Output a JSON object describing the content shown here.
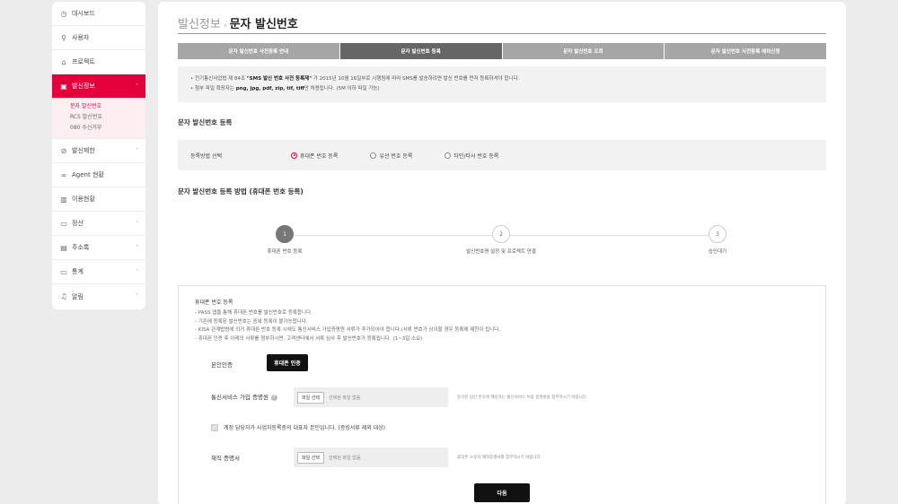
{
  "sidebar": {
    "items": [
      {
        "label": "대시보드",
        "icon": "dashboard-icon",
        "glyph": "◷"
      },
      {
        "label": "사용자",
        "icon": "user-icon",
        "glyph": "⚲"
      },
      {
        "label": "프로젝트",
        "icon": "project-icon",
        "glyph": "⌂"
      },
      {
        "label": "발신정보",
        "icon": "sender-info-icon",
        "glyph": "▣"
      },
      {
        "label": "발신제한",
        "icon": "block-icon",
        "glyph": "⊘"
      },
      {
        "label": "Agent 현황",
        "icon": "link-icon",
        "glyph": "∞"
      },
      {
        "label": "이용현황",
        "icon": "usage-chart-icon",
        "glyph": "▥"
      },
      {
        "label": "정산",
        "icon": "billing-icon",
        "glyph": "▭"
      },
      {
        "label": "주소록",
        "icon": "address-book-icon",
        "glyph": "▤"
      },
      {
        "label": "통계",
        "icon": "stats-monitor-icon",
        "glyph": "▭"
      },
      {
        "label": "알림",
        "icon": "bell-icon",
        "glyph": "♫"
      }
    ],
    "sub_items": [
      "문자 발신번호",
      "RCS 발신번호",
      "080 수신거부"
    ],
    "chevron_down": "˅",
    "chevron_up": "˄"
  },
  "breadcrumb": {
    "parent": "발신정보",
    "separator": "›",
    "current": "문자 발신번호"
  },
  "tabs": [
    "문자 발신번호 사전등록 안내",
    "문자 발신번호 등록",
    "문자 발신번호 조회",
    "문자 발신번호 사전등록 예외신청"
  ],
  "notice": {
    "line1_pre": "• 전기통신사업법 제 84조 ",
    "line1_bold": "\"SMS 발신 번호 사전 등록제\"",
    "line1_post": " 가 2015년 10월 16일부로 시행됨에 따라 SMS를 발송하려면 발신 번호를 먼저 등록하셔야 합니다.",
    "line2_pre": "• 첨부 파일 확장자는 ",
    "line2_bold": "png, jpg, pdf, zip, tif, tiff",
    "line2_post": "만 허용됩니다. (5M 이하 파일 가능)"
  },
  "register_section_title": "문자 발신번호 등록",
  "method": {
    "label": "등록방법 선택",
    "options": [
      "휴대폰 번호 등록",
      "유선 번호 등록",
      "타인/타사 번호 등록"
    ]
  },
  "method_section_title": "문자 발신번호 등록 방법 (휴대폰 번호 등록)",
  "steps": [
    {
      "num": "1",
      "label": "휴대폰 번호 등록"
    },
    {
      "num": "2",
      "label": "발신번호명 설정 및 프로젝트 연결"
    },
    {
      "num": "3",
      "label": "승인대기"
    }
  ],
  "form": {
    "title": "휴대폰 번호 등록",
    "guide": [
      "- PASS 앱을 통해 휴대폰 번호를 발신번호로 등록합니다.",
      "- 기존에 등록된 발신번호는 중복 등록이 불가능합니다.",
      "- KISA 관계법령에 의거 휴대폰 번호 등록 시에도 통신서비스 가입증명원 서류가 추가되어야 합니다.(서류 번호가 상이할 경우 등록에 제한이 됩니다.",
      "- 휴대폰 인증 후 아래의 서류를 첨부하시면, 고객센터에서 서류 심사 후 발신번호가 등록됩니다. (1~3일 소요)"
    ],
    "verify_label": "본인인증",
    "verify_button": "휴대폰 인증",
    "cert_label": "통신서비스 가입 증명원",
    "help_glyph": "?",
    "file_button": "파일 선택",
    "file_placeholder": "선택된 파일 없음",
    "cert_hint": "등기된 입신 번호에 해당하는 통신서비스 이용 증명원을 첨부하시기 바랍니다.",
    "checkbox_label": "계정 담당자가 사업자등록증의 대표자 본인입니다. (증빙서류 제외 대상)",
    "employment_label": "재직 증명서",
    "employment_hint": "휴대폰 소유자 재직증명서를 첨부하시기 바랍니다.",
    "next_button": "다음"
  }
}
